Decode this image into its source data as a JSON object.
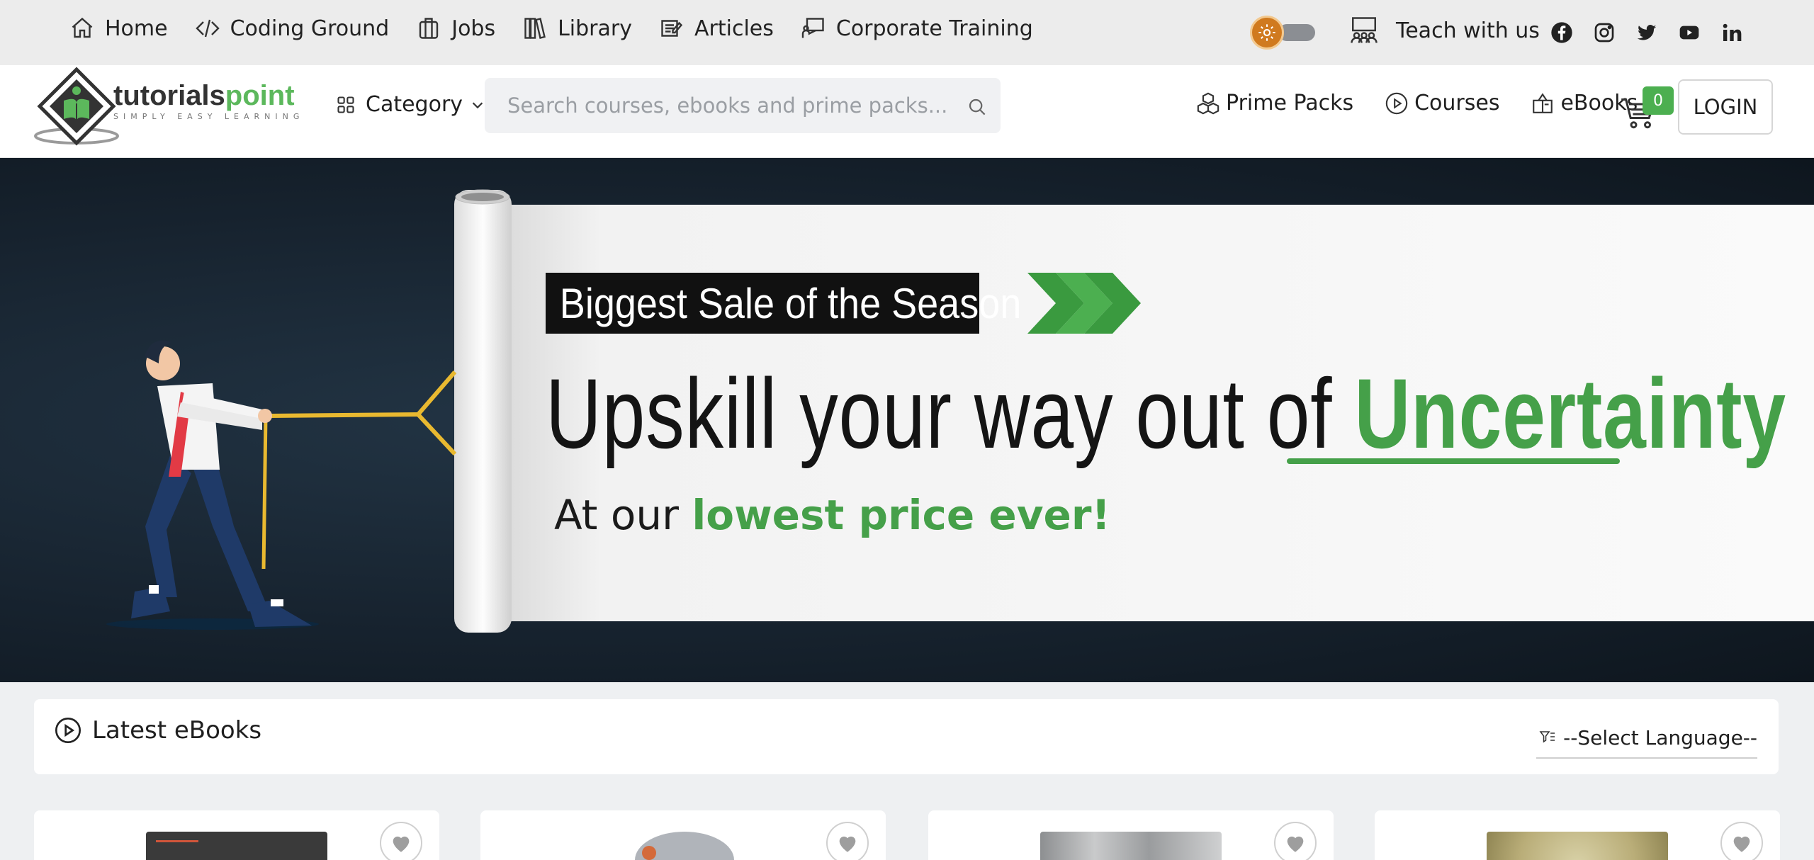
{
  "topnav": {
    "items": [
      {
        "label": "Home",
        "icon": "home-icon"
      },
      {
        "label": "Coding Ground",
        "icon": "code-icon"
      },
      {
        "label": "Jobs",
        "icon": "briefcase-icon"
      },
      {
        "label": "Library",
        "icon": "books-icon"
      },
      {
        "label": "Articles",
        "icon": "article-icon"
      },
      {
        "label": "Corporate Training",
        "icon": "presentation-icon"
      }
    ],
    "teach_label": "Teach with us",
    "social": [
      "facebook-icon",
      "instagram-icon",
      "twitter-icon",
      "youtube-icon",
      "linkedin-icon"
    ],
    "theme_toggle_state": "off"
  },
  "header": {
    "logo_alt": "tutorialspoint",
    "logo_tagline": "SIMPLY EASY LEARNING",
    "category_label": "Category",
    "search_placeholder": "Search courses, ebooks and prime packs...",
    "nav": [
      {
        "label": "Prime Packs",
        "icon": "cubes-icon"
      },
      {
        "label": "Courses",
        "icon": "play-circle-icon"
      },
      {
        "label": "eBooks",
        "icon": "open-book-icon"
      }
    ],
    "cart_count": "0",
    "login_label": "LOGIN"
  },
  "banner": {
    "tag": "Biggest Sale of the Season",
    "headline_prefix": "Upskill your way out of ",
    "headline_highlight": "Uncertainty",
    "subline_prefix": "At our ",
    "subline_highlight": "lowest price ever!"
  },
  "latest": {
    "title": "Latest eBooks",
    "language_select": "--Select Language--"
  },
  "colors": {
    "brand_green": "#45a049",
    "toggle_orange": "#d07a1f",
    "badge_green": "#4caf50"
  }
}
